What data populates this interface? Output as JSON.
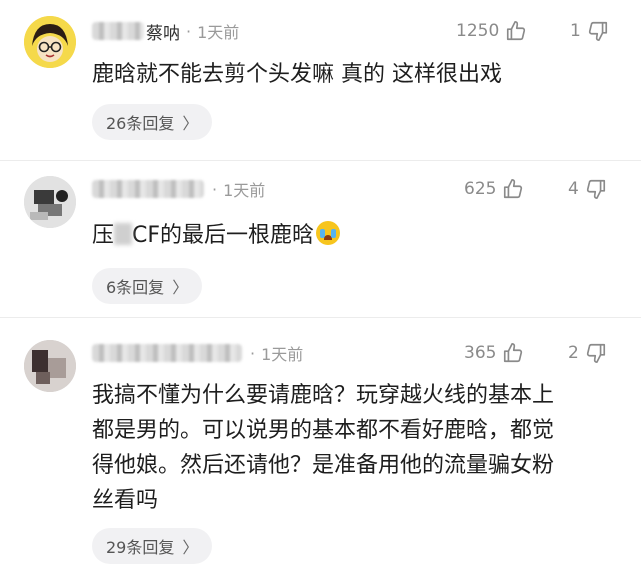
{
  "comments": [
    {
      "username": "蔡呐",
      "separator": "·",
      "time": "1天前",
      "likes": "1250",
      "dislikes": "1",
      "text": "鹿晗就不能去剪个头发嘛 真的 这样很出戏",
      "replies": "26条回复"
    },
    {
      "username": "",
      "separator": "·",
      "time": "1天前",
      "likes": "625",
      "dislikes": "4",
      "text_before_blur": "压",
      "text_after_blur": "CF的最后一根鹿晗",
      "emoji": "crying-face-emoji",
      "replies": "6条回复"
    },
    {
      "username": "",
      "separator": "·",
      "time": "1天前",
      "likes": "365",
      "dislikes": "2",
      "text": "我搞不懂为什么要请鹿晗？玩穿越火线的基本上\n都是男的。可以说男的基本都不看好鹿晗，都觉\n得他娘。然后还请他？是准备用他的流量骗女粉\n丝看吗",
      "replies": "29条回复"
    }
  ],
  "reply_chevron": "〉",
  "icons": {
    "like": "thumbs-up-icon",
    "dislike": "thumbs-down-icon"
  },
  "colors": {
    "meta": "#9a9a9a",
    "text": "#1e1e1e",
    "pill_bg": "#f1f1f3"
  }
}
